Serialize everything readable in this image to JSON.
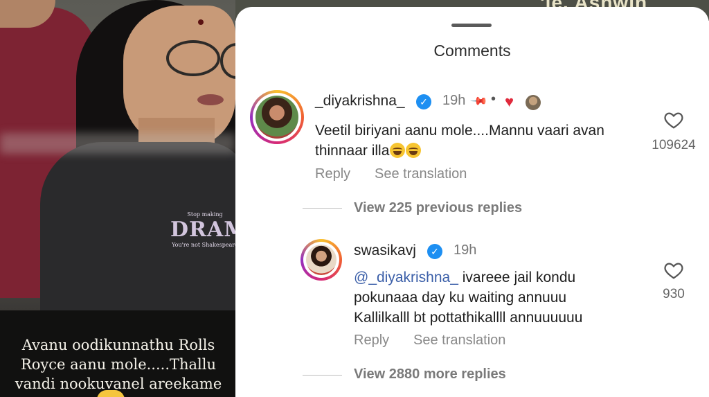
{
  "video": {
    "shirt_small_top": "Stop making",
    "shirt_big": "DRAMA",
    "shirt_small_bottom": "You're not Shakespeare",
    "caption": "Avanu oodikunnathu Rolls Royce aanu mole.....Thallu vandi nookuvanel areekame",
    "behind_sheet_text": "'le. Ashwin"
  },
  "sheet": {
    "title": "Comments"
  },
  "comments": [
    {
      "username": "_diyakrishna_",
      "verified": true,
      "time": "19h",
      "pinned": true,
      "liked_by_author": true,
      "text": "Veetil biriyani aanu mole....Mannu vaari avan thinnaar illa",
      "emoji": "face-with-tears-of-joy",
      "likes": "109624",
      "reply_label": "Reply",
      "translate_label": "See translation",
      "view_replies": "View 225 previous replies"
    },
    {
      "username": "swasikavj",
      "verified": true,
      "time": "19h",
      "mention": "@_diyakrishna_",
      "text_line1": " ivareee jail kondu",
      "text_line2": "pokunaaa day ku waiting annuuu",
      "text_line3": "Kallilkalll bt pottathikallll annuuuuuu",
      "likes": "930",
      "reply_label": "Reply",
      "translate_label": "See translation",
      "view_replies": "View 2880 more replies"
    }
  ],
  "icons": {
    "verified": "verified-badge-icon",
    "pin": "pin-icon",
    "heart_filled": "red-heart-icon",
    "like": "heart-outline-icon"
  },
  "colors": {
    "verified_blue": "#1d8ff2",
    "mention_blue": "#3a5ea8",
    "heart_red": "#e02a3c"
  }
}
